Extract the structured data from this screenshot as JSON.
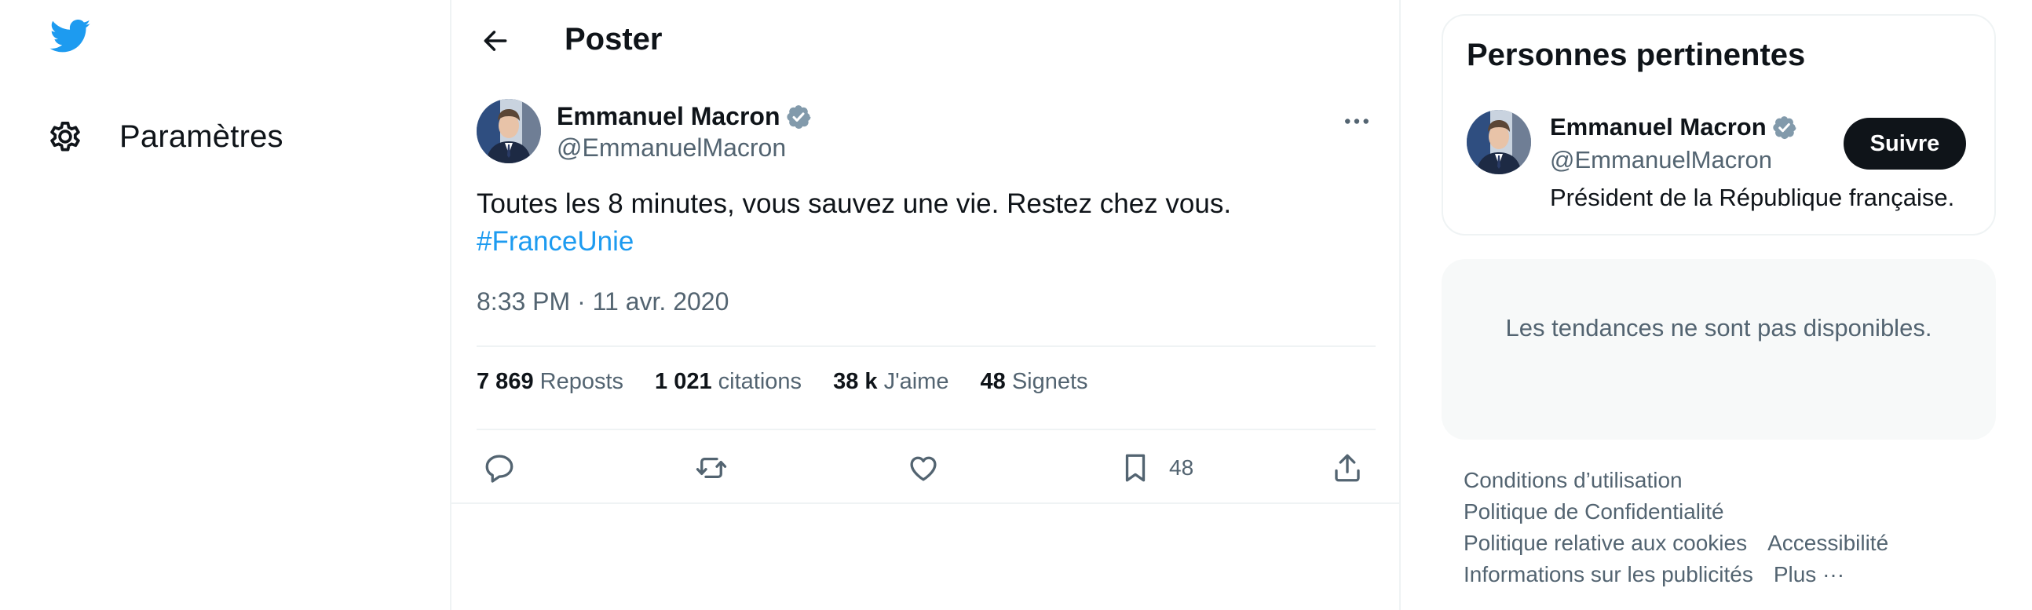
{
  "nav": {
    "logo_icon": "twitter-bird-icon",
    "settings_label": "Paramètres",
    "settings_icon": "gear-icon"
  },
  "header": {
    "title": "Poster",
    "back_icon": "arrow-left-icon"
  },
  "tweet": {
    "author_name": "Emmanuel Macron",
    "author_handle": "@EmmanuelMacron",
    "verified_icon": "verified-badge-icon",
    "more_icon": "more-horizontal-icon",
    "text": "Toutes les 8 minutes, vous sauvez une vie. Restez chez vous.",
    "hashtag": "#FranceUnie",
    "timestamp": "8:33 PM · 11 avr. 2020",
    "stats": {
      "reposts_count": "7 869",
      "reposts_label": "Reposts",
      "quotes_count": "1 021",
      "quotes_label": "citations",
      "likes_count": "38 k",
      "likes_label": "J'aime",
      "bookmarks_count": "48",
      "bookmarks_label": "Signets"
    },
    "actions": {
      "reply_icon": "reply-icon",
      "repost_icon": "repost-icon",
      "like_icon": "heart-icon",
      "bookmark_icon": "bookmark-icon",
      "bookmark_count": "48",
      "share_icon": "share-icon"
    }
  },
  "sidebar": {
    "people_title": "Personnes pertinentes",
    "person": {
      "name": "Emmanuel Macron",
      "handle": "@EmmanuelMacron",
      "bio": "Président de la République française.",
      "follow_label": "Suivre"
    },
    "trends_unavailable": "Les tendances ne sont pas disponibles."
  },
  "footer": {
    "terms": "Conditions d’utilisation",
    "privacy": "Politique de Confidentialité",
    "cookies": "Politique relative aux cookies",
    "accessibility": "Accessibilité",
    "ads_info": "Informations sur les publicités",
    "more": "Plus ···"
  },
  "colors": {
    "accent": "#1d9bf0",
    "text_primary": "#0f1419",
    "text_secondary": "#536471",
    "border": "#eff3f4",
    "panel_bg": "#f7f9f9",
    "verified": "#829aab"
  }
}
